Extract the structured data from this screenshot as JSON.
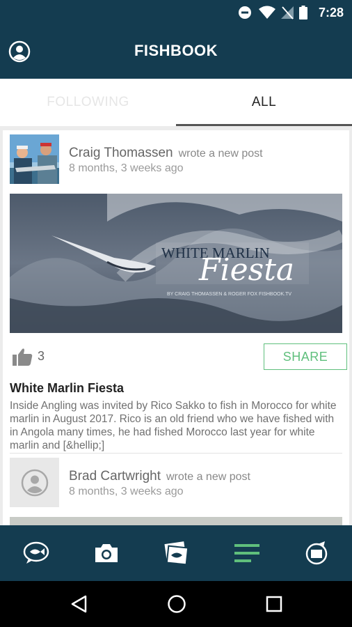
{
  "status_bar": {
    "time": "7:28"
  },
  "app_bar": {
    "title": "FISHBOOK"
  },
  "tabs": [
    {
      "label": "FOLLOWING",
      "selected": false
    },
    {
      "label": "ALL",
      "selected": true
    }
  ],
  "posts": [
    {
      "author": "Craig Thomassen",
      "action": "wrote a new post",
      "time_ago": "8 months, 3 weeks ago",
      "hero": {
        "title_top": "WHITE MARLIN",
        "title_script": "Fiesta",
        "byline": "BY CRAIG THOMASSEN & ROGER FOX FISHBOOK.TV"
      },
      "likes": "3",
      "share_label": "SHARE",
      "title": "White Marlin Fiesta",
      "excerpt": "Inside Angling was invited by Rico Sakko to fish in Morocco for white marlin in August 2017. Rico is an old friend who we have fished with in Angola many times, he had fished Morocco last year for white marlin and [&hellip;]"
    },
    {
      "author": "Brad Cartwright",
      "action": "wrote a new post",
      "time_ago": "8 months, 3 weeks ago"
    }
  ],
  "bottom_nav": [
    {
      "icon": "fish-chat-icon"
    },
    {
      "icon": "camera-icon"
    },
    {
      "icon": "photo-gallery-icon"
    },
    {
      "icon": "feed-icon",
      "active": true
    },
    {
      "icon": "video-icon"
    }
  ],
  "colors": {
    "primary": "#143c50",
    "accent": "#5fbf7c",
    "active_nav": "#5fbf7c"
  }
}
